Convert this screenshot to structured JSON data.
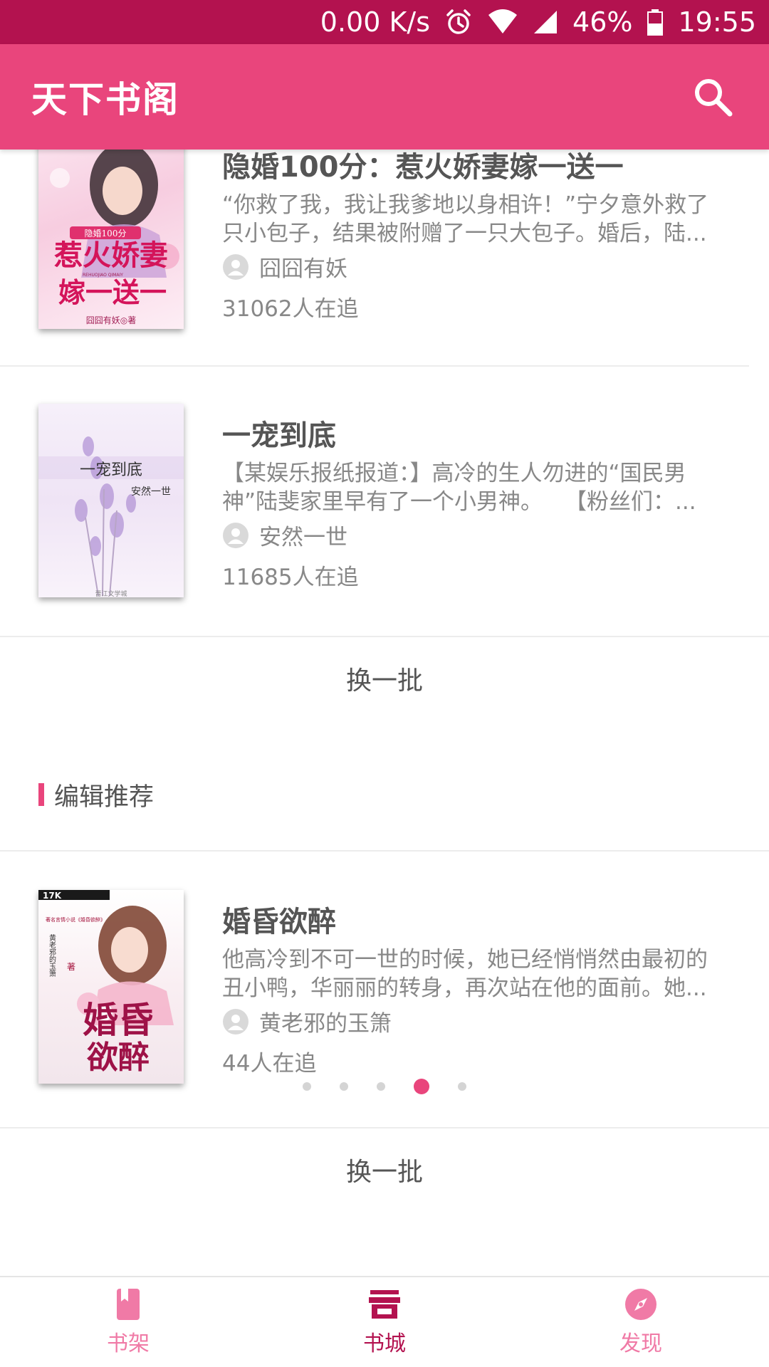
{
  "status_bar": {
    "speed": "0.00 K/s",
    "battery": "46%",
    "time": "19:55"
  },
  "app_bar": {
    "title": "天下书阁"
  },
  "books_top": [
    {
      "title": "隐婚100分：惹火娇妻嫁一送一",
      "description": "“你救了我，我让我爹地以身相许！”宁夕意外救了只小包子，结果被附赠了一只大包子。婚后，陆...",
      "author": "囧囧有妖",
      "readers": "31062人在追",
      "cover": {
        "top_text": "隐婚100分",
        "main_text": "惹火娇妻",
        "sub_text": "嫁一送一",
        "pinyin": "REHUOJIAO QIMAIY",
        "author_text": "囧囧有妖◎著"
      }
    },
    {
      "title": "一宠到底",
      "description": "【某娱乐报纸报道：】高冷的生人勿进的“国民男神”陆斐家里早有了一个小男神。　　【粉丝们：...",
      "author": "安然一世",
      "readers": "11685人在追",
      "cover": {
        "main_text": "一宠到底",
        "sub_text": "安然一世",
        "footer_text": "晋江文学城"
      }
    }
  ],
  "refresh_label_1": "换一批",
  "section": {
    "title": "编辑推荐"
  },
  "featured_book": {
    "title": "婚昏欲醉",
    "description": "他高冷到不可一世的时候，她已经悄悄然由最初的丑小鸭，华丽丽的转身，再次站在他的面前。她...",
    "author": "黄老邪的玉箫",
    "readers": "44人在追",
    "cover": {
      "logo": "17K",
      "series_text": "著名言情小说《婚昏欲醉》",
      "author_text": "黄老邪的玉箫",
      "zhu": "著",
      "main_text": "婚昏",
      "sub_text": "欲醉"
    }
  },
  "pager": {
    "count": 5,
    "active_index": 3
  },
  "refresh_label_2": "换一批",
  "bottom_nav": [
    {
      "label": "书架",
      "icon": "book-icon",
      "active": false
    },
    {
      "label": "书城",
      "icon": "store-icon",
      "active": true
    },
    {
      "label": "发现",
      "icon": "compass-icon",
      "active": false
    }
  ],
  "colors": {
    "status_bar": "#b3124f",
    "app_bar": "#e9457c",
    "accent": "#e9457c",
    "active_nav": "#b3124f",
    "inactive_nav": "#f07aa6"
  }
}
